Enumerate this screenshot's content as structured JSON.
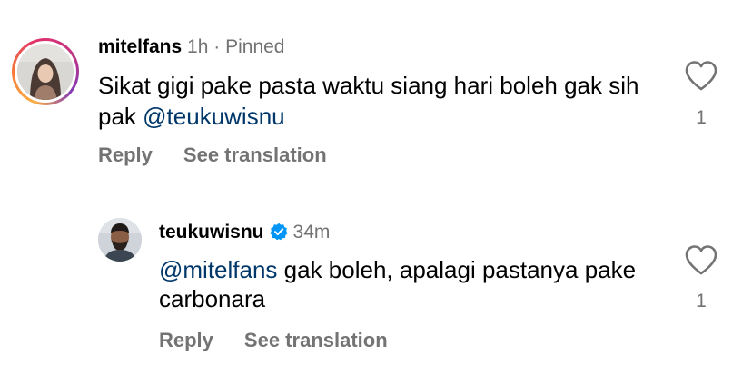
{
  "comment": {
    "username": "mitelfans",
    "time": "1h",
    "separator": "·",
    "pinned_label": "Pinned",
    "text": "Sikat gigi pake pasta waktu siang hari boleh gak sih pak ",
    "mention": "@teukuwisnu",
    "like_count": "1",
    "reply_label": "Reply",
    "translate_label": "See translation",
    "like_icon": "heart-outline-icon"
  },
  "reply": {
    "username": "teukuwisnu",
    "verified_icon": "verified-badge-icon",
    "time": "34m",
    "mention": "@mitelfans",
    "text": " gak boleh, apalagi pastanya pake carbonara",
    "like_count": "1",
    "reply_label": "Reply",
    "translate_label": "See translation",
    "like_icon": "heart-outline-icon"
  },
  "colors": {
    "primary_text": "#000000",
    "secondary_text": "#737373",
    "mention": "#00376b",
    "verified": "#0095f6",
    "story_ring": [
      "#fcaf45",
      "#f77737",
      "#e1306c",
      "#c13584",
      "#833ab4"
    ]
  }
}
